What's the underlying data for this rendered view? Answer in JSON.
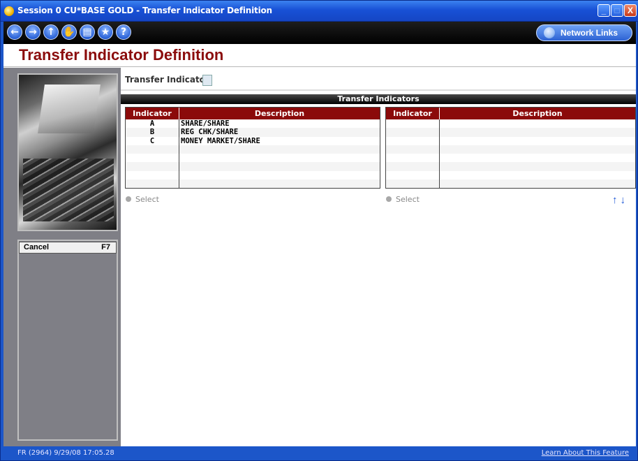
{
  "window": {
    "title": "Session 0 CU*BASE GOLD - Transfer Indicator Definition",
    "min_glyph": "_",
    "max_glyph": "□",
    "close_glyph": "X"
  },
  "toolbar": {
    "back_glyph": "←",
    "forward_glyph": "→",
    "up_glyph": "↑",
    "stop_glyph": "✋",
    "print_glyph": "▤",
    "favorite_glyph": "★",
    "help_glyph": "?",
    "network_links_label": "Network Links"
  },
  "page": {
    "title": "Transfer Indicator Definition",
    "transfer_indicator_label": "Transfer Indicator",
    "transfer_indicator_value": "",
    "section_title": "Transfer Indicators"
  },
  "left_table": {
    "headers": [
      "Indicator",
      "Description"
    ],
    "rows": [
      [
        "A",
        "SHARE/SHARE"
      ],
      [
        "B",
        "REG CHK/SHARE"
      ],
      [
        "C",
        "MONEY MARKET/SHARE"
      ],
      [
        "",
        ""
      ],
      [
        "",
        ""
      ],
      [
        "",
        ""
      ],
      [
        "",
        ""
      ],
      [
        "",
        ""
      ]
    ],
    "select_label": "Select"
  },
  "right_table": {
    "headers": [
      "Indicator",
      "Description"
    ],
    "rows": [
      [
        "",
        ""
      ],
      [
        "",
        ""
      ],
      [
        "",
        ""
      ],
      [
        "",
        ""
      ],
      [
        "",
        ""
      ],
      [
        "",
        ""
      ],
      [
        "",
        ""
      ],
      [
        "",
        ""
      ]
    ],
    "select_label": "Select"
  },
  "sidebar": {
    "cancel_label": "Cancel",
    "cancel_key": "F7"
  },
  "scroll": {
    "up_glyph": "↑",
    "down_glyph": "↓"
  },
  "status": {
    "left_text": "FR (2964) 9/29/08 17:05.28",
    "right_link": "Learn About This Feature"
  },
  "colors": {
    "title_red": "#8b0c0c",
    "header_red": "#8b0a0a",
    "chrome_blue": "#1c56c9"
  }
}
